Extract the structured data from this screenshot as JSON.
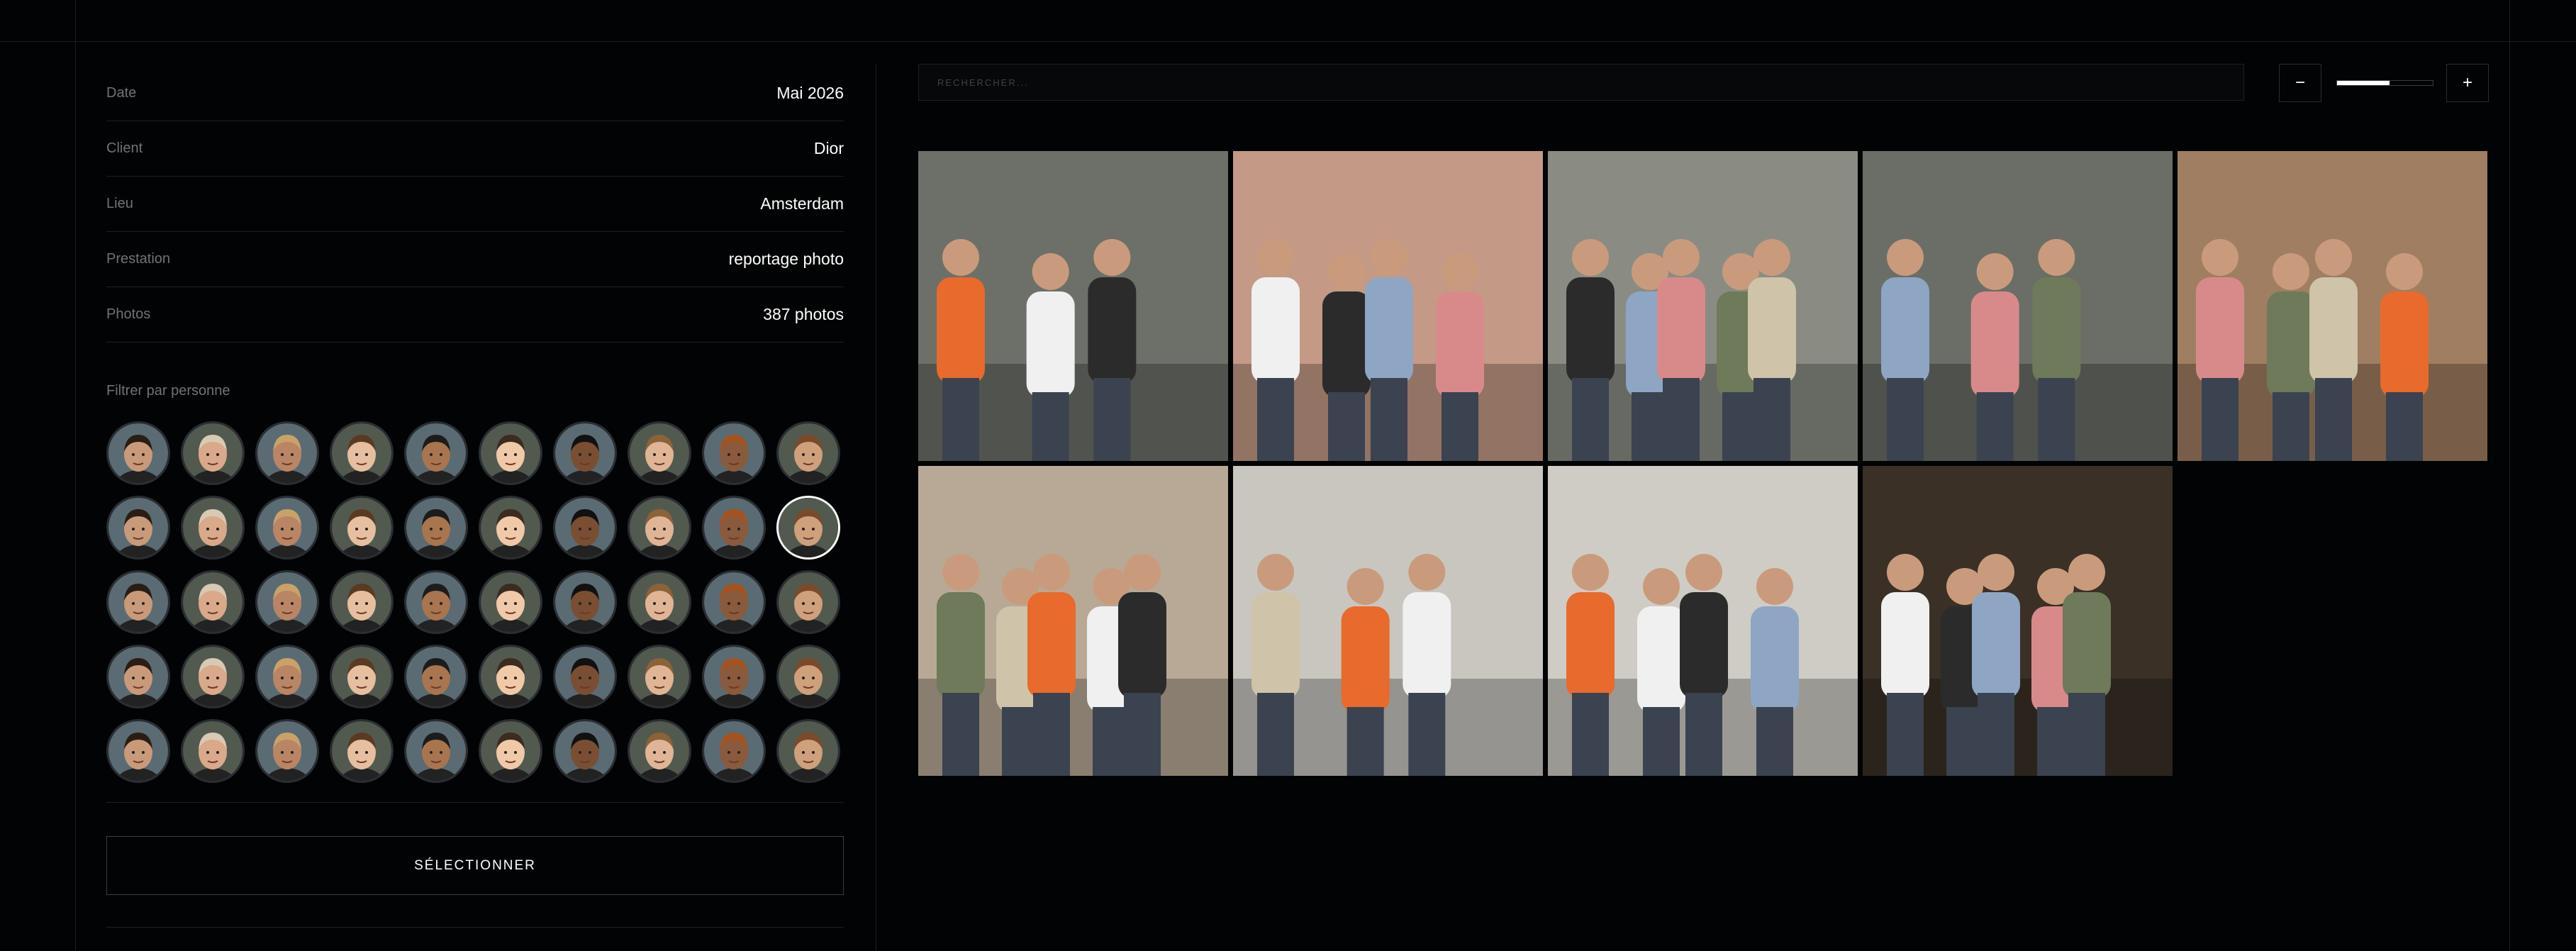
{
  "project": {
    "fields": [
      {
        "label": "Date",
        "value": "Mai 2026"
      },
      {
        "label": "Client",
        "value": "Dior"
      },
      {
        "label": "Lieu",
        "value": "Amsterdam"
      },
      {
        "label": "Prestation",
        "value": "reportage photo"
      },
      {
        "label": "Photos",
        "value": "387 photos"
      }
    ]
  },
  "filter": {
    "title": "Filtrer par personne",
    "selected_index": 19,
    "face_count": 50
  },
  "actions": {
    "select_label": "SÉLECTIONNER"
  },
  "search": {
    "placeholder": "RECHERCHER..."
  },
  "zoom": {
    "minus_label": "−",
    "plus_label": "+",
    "level": 0.55
  },
  "photos": [
    {
      "scene": "street-group-cameras",
      "tone": "#6c7068"
    },
    {
      "scene": "boat-couple-laughing",
      "tone": "#c49a86"
    },
    {
      "scene": "boat-group-drinks",
      "tone": "#8a8c84"
    },
    {
      "scene": "street-group-cameras-wide",
      "tone": "#6a6e66"
    },
    {
      "scene": "cafe-laptops-waving",
      "tone": "#a07e62"
    },
    {
      "scene": "office-seated-listeners",
      "tone": "#b8a996"
    },
    {
      "scene": "studio-people-standing",
      "tone": "#c9c6c0"
    },
    {
      "scene": "studio-trio-standing",
      "tone": "#cfccc5"
    },
    {
      "scene": "bar-men-drinks",
      "tone": "#3a3026"
    }
  ]
}
